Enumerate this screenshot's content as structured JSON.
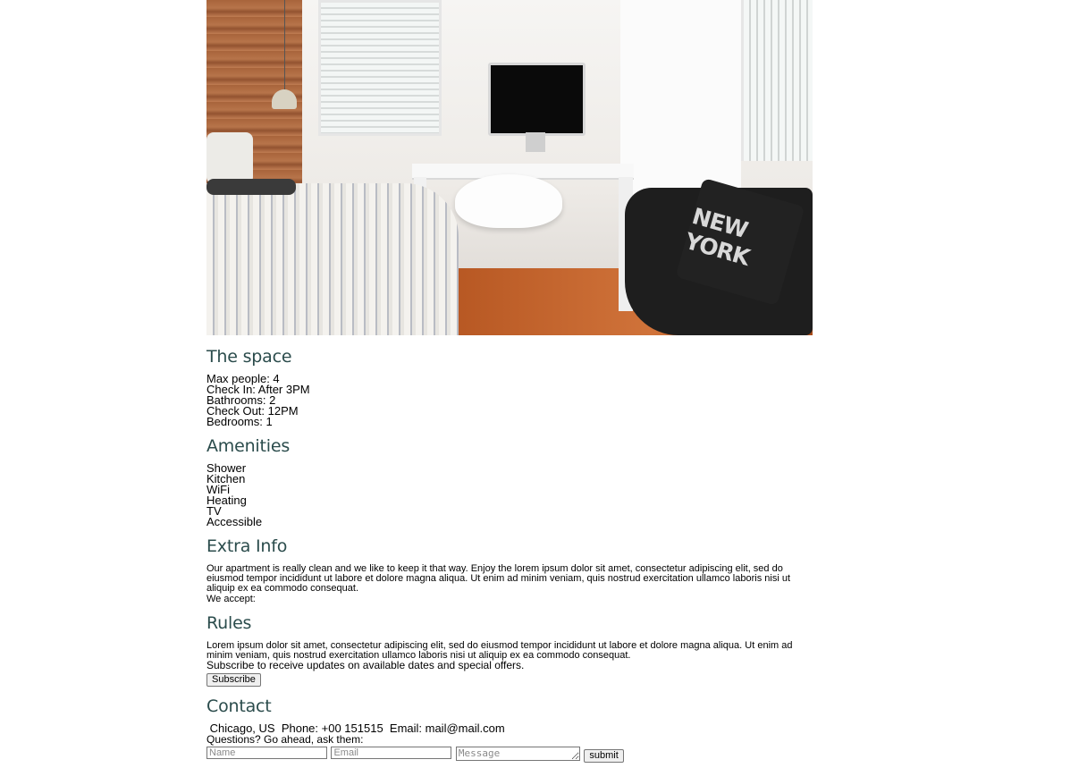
{
  "space": {
    "title": "The space",
    "items": [
      "Max people: 4",
      "Check In: After 3PM",
      "Bathrooms: 2",
      "Check Out: 12PM",
      "Bedrooms: 1"
    ]
  },
  "amenities": {
    "title": "Amenities",
    "items": [
      "Shower",
      "Kitchen",
      "WiFi",
      "Heating",
      "TV",
      "Accessible"
    ]
  },
  "extra": {
    "title": "Extra Info",
    "text": "Our apartment is really clean and we like to keep it that way. Enjoy the lorem ipsum dolor sit amet, consectetur adipiscing elit, sed do eiusmod tempor incididunt ut labore et dolore magna aliqua. Ut enim ad minim veniam, quis nostrud exercitation ullamco laboris nisi ut aliquip ex ea commodo consequat.",
    "accept": "We accept:"
  },
  "rules": {
    "title": "Rules",
    "text": "Lorem ipsum dolor sit amet, consectetur adipiscing elit, sed do eiusmod tempor incididunt ut labore et dolore magna aliqua. Ut enim ad minim veniam, quis nostrud exercitation ullamco laboris nisi ut aliquip ex ea commodo consequat.",
    "subscribe_text": "Subscribe to receive updates on available dates and special offers.",
    "subscribe_button": "Subscribe"
  },
  "contact": {
    "title": "Contact",
    "info": " Chicago, US  Phone: +00 151515  Email: mail@mail.com",
    "questions": "Questions? Go ahead, ask them:",
    "name_placeholder": "Name",
    "email_placeholder": "Email",
    "message_placeholder": "Message",
    "submit_label": "submit"
  },
  "hero": {
    "pillow_text": "NEW YORK",
    "colors": {
      "heading": "#2b4c4c"
    }
  }
}
